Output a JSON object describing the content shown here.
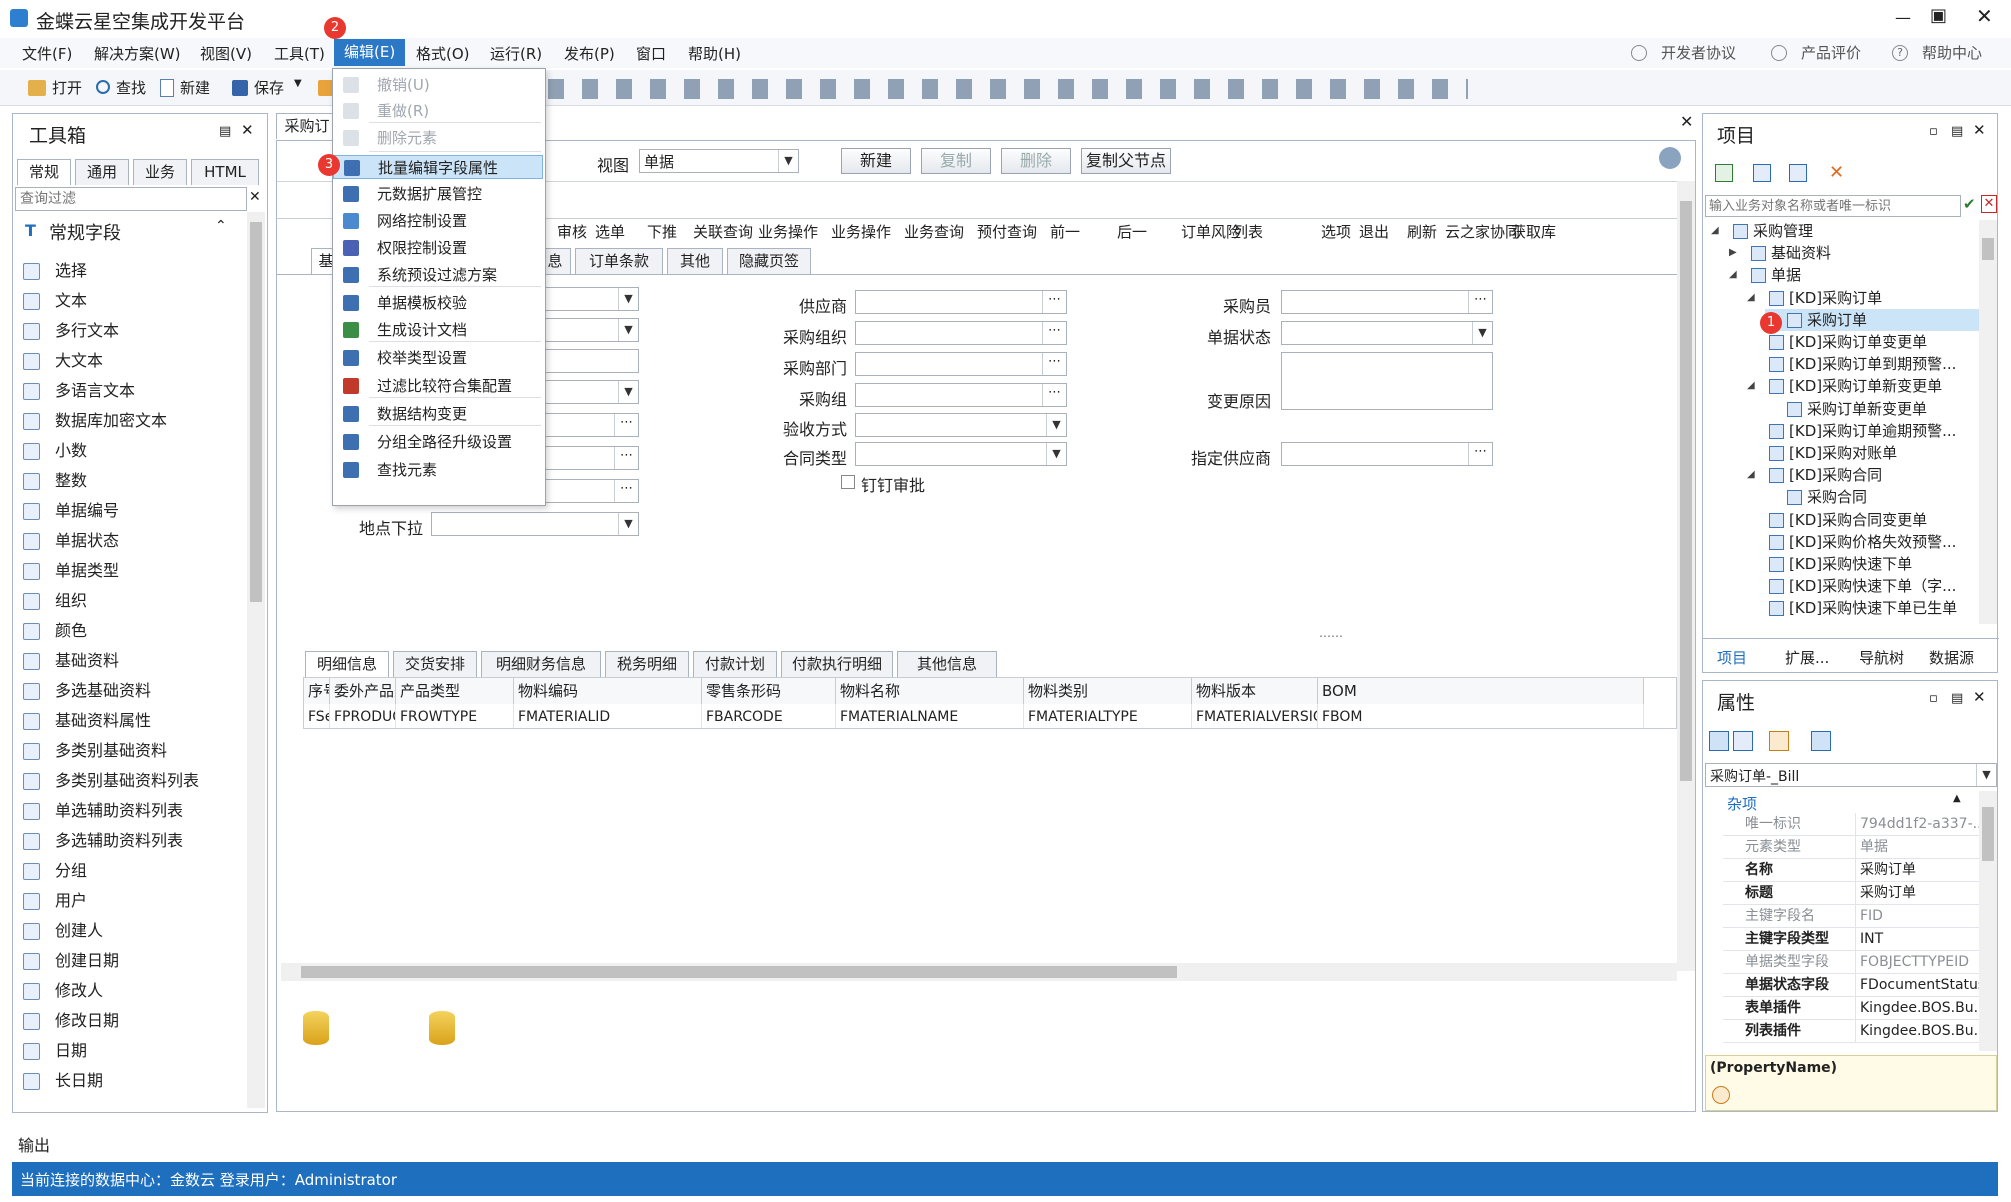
{
  "window": {
    "title": "金蝶云星空集成开发平台"
  },
  "menus": [
    "文件(F)",
    "解决方案(W)",
    "视图(V)",
    "工具(T)",
    "编辑(E)",
    "格式(O)",
    "运行(R)",
    "发布(P)",
    "窗口",
    "帮助(H)"
  ],
  "menu_right": {
    "dev": "开发者协议",
    "rate": "产品评价",
    "help": "帮助中心"
  },
  "toolbar": {
    "open": "打开",
    "find": "查找",
    "new": "新建",
    "save": "保存"
  },
  "badges": {
    "tree": "1",
    "menu": "2",
    "item": "3"
  },
  "edit_menu": {
    "items": [
      {
        "label": "撤销(U)",
        "disabled": true
      },
      {
        "label": "重做(R)",
        "disabled": true
      },
      {
        "label": "删除元素",
        "disabled": true
      },
      {
        "label": "批量编辑字段属性",
        "disabled": false
      },
      {
        "label": "元数据扩展管控",
        "disabled": false
      },
      {
        "label": "网络控制设置",
        "disabled": false
      },
      {
        "label": "权限控制设置",
        "disabled": false
      },
      {
        "label": "系统预设过滤方案",
        "disabled": false
      },
      {
        "label": "单据模板校验",
        "disabled": false
      },
      {
        "label": "生成设计文档",
        "disabled": false
      },
      {
        "label": "校举类型设置",
        "disabled": false
      },
      {
        "label": "过滤比较符合集配置",
        "disabled": false
      },
      {
        "label": "数据结构变更",
        "disabled": false
      },
      {
        "label": "分组全路径升级设置",
        "disabled": false
      },
      {
        "label": "查找元素",
        "disabled": false
      }
    ]
  },
  "toolbox": {
    "title": "工具箱",
    "tabs": [
      "常规",
      "通用",
      "业务",
      "HTML"
    ],
    "filter_placeholder": "查询过滤",
    "section": "常规字段",
    "items": [
      "选择",
      "文本",
      "多行文本",
      "大文本",
      "多语言文本",
      "数据库加密文本",
      "小数",
      "整数",
      "单据编号",
      "单据状态",
      "单据类型",
      "组织",
      "颜色",
      "基础资料",
      "多选基础资料",
      "基础资料属性",
      "多类别基础资料",
      "多类别基础资料列表",
      "单选辅助资料列表",
      "多选辅助资料列表",
      "分组",
      "用户",
      "创建人",
      "创建日期",
      "修改人",
      "修改日期",
      "日期",
      "长日期"
    ]
  },
  "doc": {
    "tab": "采购订",
    "view_label": "视图",
    "view_value": "单据",
    "buttons": {
      "new": "新建",
      "copy": "复制",
      "delete": "删除",
      "copy_parent": "复制父节点"
    },
    "bill_toolbar": [
      "审核",
      "选单",
      "下推",
      "关联查询",
      "业务操作",
      "业务操作",
      "业务查询",
      "预付查询",
      "前一",
      "后一",
      "订单风险",
      "列表",
      "选项",
      "退出",
      "刷新",
      "云之家协同",
      "获取库"
    ],
    "form_tabs": [
      "基",
      "息",
      "订单条款",
      "其他",
      "隐藏页签"
    ],
    "labels": {
      "supplier": "供应商",
      "purchase_org": "采购组织",
      "purchase_dept": "采购部门",
      "purchase_group": "采购组",
      "acceptance": "验收方式",
      "contract_type": "合同类型",
      "pin_approve": "钉钉审批",
      "buyer": "采购员",
      "bill_status": "单据状态",
      "change_reason": "变更原因",
      "designated_supplier": "指定供应商",
      "location": "地点下拉"
    },
    "detail_tabs": [
      "明细信息",
      "交货安排",
      "明细财务信息",
      "税务明细",
      "付款计划",
      "付款执行明细",
      "其他信息"
    ],
    "grid": {
      "headers": [
        "序号",
        "委外产品类型",
        "产品类型",
        "物料编码",
        "零售条形码",
        "物料名称",
        "物料类别",
        "物料版本",
        "BOM"
      ],
      "row": [
        "FSeq",
        "FPRODUCTTYPE",
        "FROWTYPE",
        "FMATERIALID",
        "FBARCODE",
        "FMATERIALNAME",
        "FMATERIALTYPE",
        "FMATERIALVERSION",
        "FBOM"
      ]
    }
  },
  "project": {
    "title": "项目",
    "search_placeholder": "输入业务对象名称或者唯一标识",
    "tree": [
      {
        "label": "采购管理",
        "level": 0,
        "expand": "open"
      },
      {
        "label": "基础资料",
        "level": 1,
        "expand": "closed"
      },
      {
        "label": "单据",
        "level": 1,
        "expand": "open"
      },
      {
        "label": "[KD]采购订单",
        "level": 2,
        "expand": "open"
      },
      {
        "label": "采购订单",
        "level": 3,
        "expand": "none",
        "selected": true
      },
      {
        "label": "[KD]采购订单变更单",
        "level": 2,
        "expand": "none"
      },
      {
        "label": "[KD]采购订单到期预警...",
        "level": 2,
        "expand": "none"
      },
      {
        "label": "[KD]采购订单新变更单",
        "level": 2,
        "expand": "open"
      },
      {
        "label": "采购订单新变更单",
        "level": 3,
        "expand": "none"
      },
      {
        "label": "[KD]采购订单逾期预警...",
        "level": 2,
        "expand": "none"
      },
      {
        "label": "[KD]采购对账单",
        "level": 2,
        "expand": "none"
      },
      {
        "label": "[KD]采购合同",
        "level": 2,
        "expand": "open"
      },
      {
        "label": "采购合同",
        "level": 3,
        "expand": "none"
      },
      {
        "label": "[KD]采购合同变更单",
        "level": 2,
        "expand": "none"
      },
      {
        "label": "[KD]采购价格失效预警...",
        "level": 2,
        "expand": "none"
      },
      {
        "label": "[KD]采购快速下单",
        "level": 2,
        "expand": "none"
      },
      {
        "label": "[KD]采购快速下单（字...",
        "level": 2,
        "expand": "none"
      },
      {
        "label": "[KD]采购快速下单已生单",
        "level": 2,
        "expand": "none"
      }
    ],
    "bottom_tabs": [
      "项目",
      "扩展...",
      "导航树",
      "数据源"
    ]
  },
  "properties": {
    "title": "属性",
    "object": "采购订单-_Bill",
    "category": "杂项",
    "rows": [
      {
        "key": "唯一标识",
        "value": "794dd1f2-a337-...",
        "bold": false,
        "grey": true
      },
      {
        "key": "元素类型",
        "value": "单据",
        "bold": false,
        "grey": true
      },
      {
        "key": "名称",
        "value": "采购订单",
        "bold": true,
        "grey": false
      },
      {
        "key": "标题",
        "value": "采购订单",
        "bold": true,
        "grey": false
      },
      {
        "key": "主键字段名",
        "value": "FID",
        "bold": false,
        "grey": true
      },
      {
        "key": "主键字段类型",
        "value": "INT",
        "bold": true,
        "grey": false
      },
      {
        "key": "单据类型字段",
        "value": "FOBJECTTYPEID",
        "bold": false,
        "grey": true
      },
      {
        "key": "单据状态字段",
        "value": "FDocumentStatus",
        "bold": true,
        "grey": false
      },
      {
        "key": "表单插件",
        "value": "Kingdee.BOS.Bu...",
        "bold": true,
        "grey": false
      },
      {
        "key": "列表插件",
        "value": "Kingdee.BOS.Bu...",
        "bold": true,
        "grey": false
      }
    ],
    "desc_title": "(PropertyName)"
  },
  "output": {
    "label": "输出"
  },
  "status": {
    "text": "当前连接的数据中心：金数云  登录用户：Administrator"
  },
  "colors": {
    "accent": "#1f6fbf",
    "status_bar": "#1e6fbd",
    "badge": "#e8382f",
    "highlight": "#cce4f7"
  }
}
